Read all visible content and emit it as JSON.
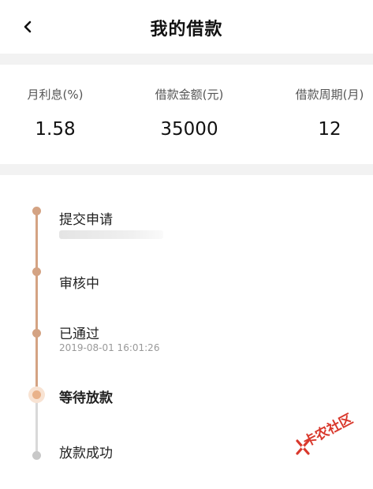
{
  "header": {
    "title": "我的借款",
    "back_icon": "chevron-left-icon"
  },
  "stats": [
    {
      "label": "月利息(%)",
      "value": "1.58"
    },
    {
      "label": "借款金额(元)",
      "value": "35000"
    },
    {
      "label": "借款周期(月)",
      "value": "12"
    }
  ],
  "timeline": {
    "steps": [
      {
        "title": "提交申请",
        "time": "",
        "status": "done"
      },
      {
        "title": "审核中",
        "time": "",
        "status": "done"
      },
      {
        "title": "已通过",
        "time": "2019-08-01 16:01:26",
        "status": "done"
      },
      {
        "title": "等待放款",
        "time": "",
        "status": "current"
      },
      {
        "title": "放款成功",
        "time": "",
        "status": "todo"
      }
    ]
  },
  "colors": {
    "accent": "#d4a383",
    "pending": "#c8c8c8",
    "watermark": "#d9382c"
  },
  "watermark": {
    "text": "卡农社区"
  }
}
